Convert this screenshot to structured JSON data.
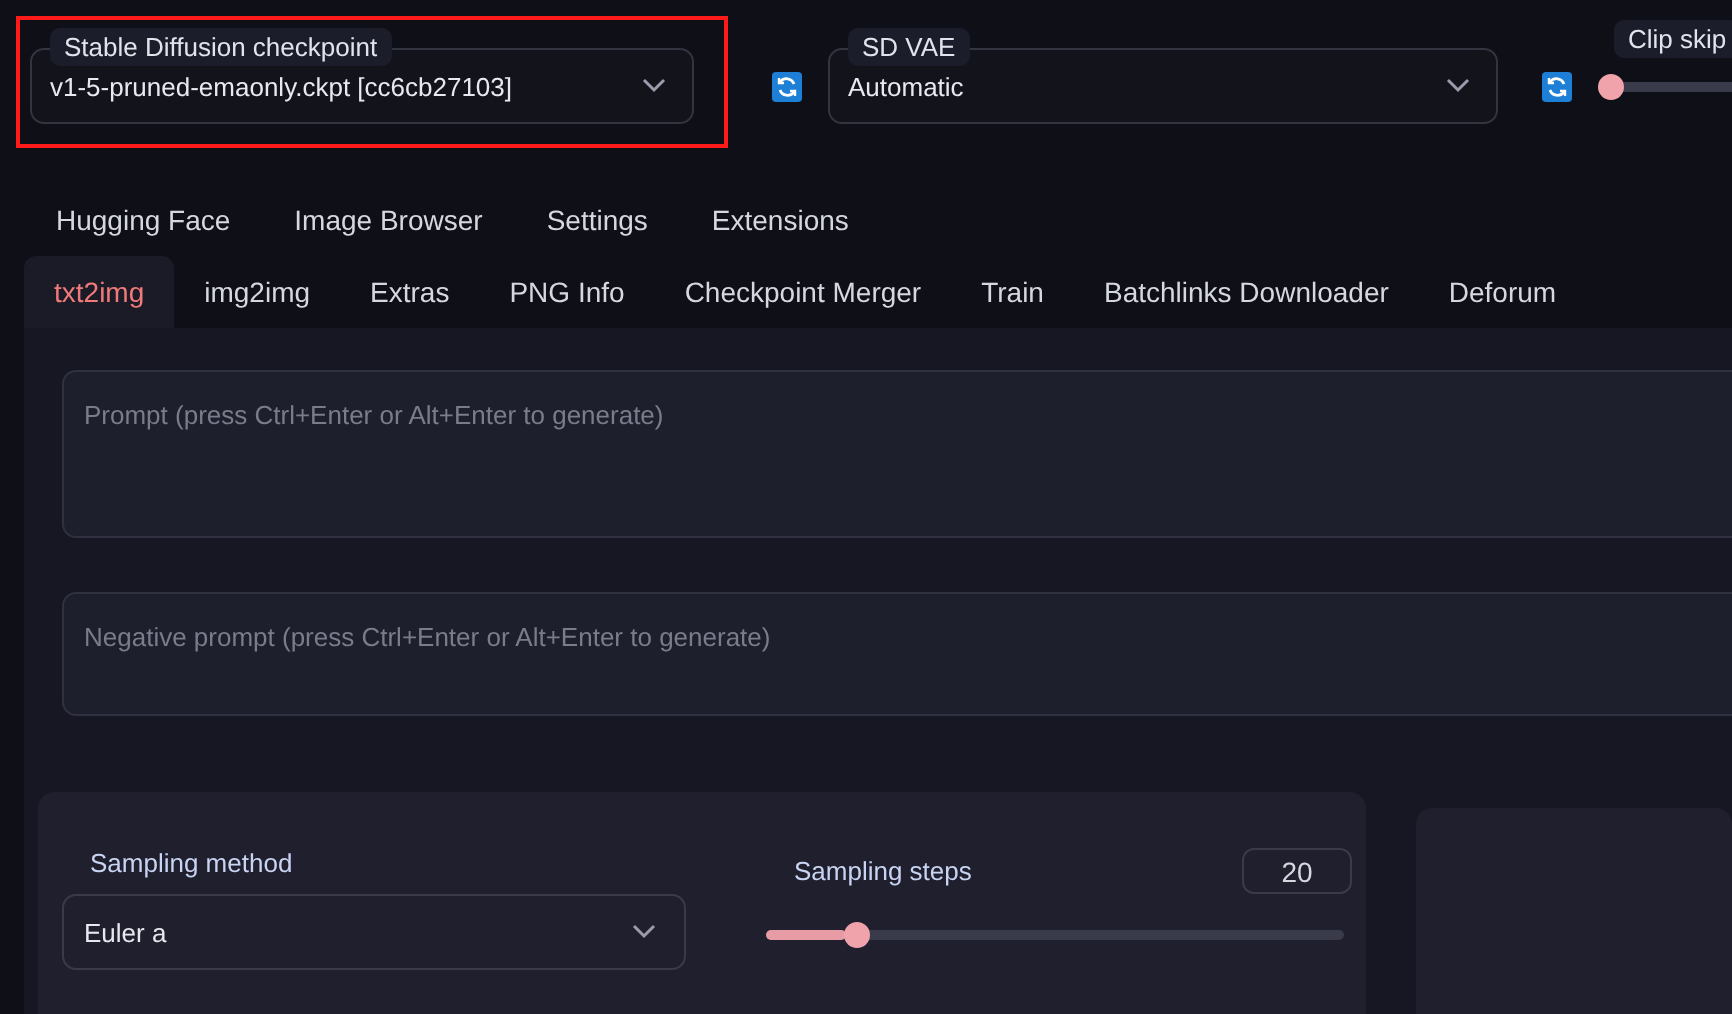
{
  "checkpoint": {
    "label": "Stable Diffusion checkpoint",
    "value": "v1-5-pruned-emaonly.ckpt [cc6cb27103]",
    "highlighted": true
  },
  "vae": {
    "label": "SD VAE",
    "value": "Automatic"
  },
  "clip_skip": {
    "label": "Clip skip",
    "level": 0
  },
  "extra_tabs": [
    {
      "label": "Hugging Face",
      "selected": false
    },
    {
      "label": "Image Browser",
      "selected": false
    },
    {
      "label": "Settings",
      "selected": false
    },
    {
      "label": "Extensions",
      "selected": false
    }
  ],
  "tabs": [
    {
      "label": "txt2img",
      "selected": true
    },
    {
      "label": "img2img",
      "selected": false
    },
    {
      "label": "Extras",
      "selected": false
    },
    {
      "label": "PNG Info",
      "selected": false
    },
    {
      "label": "Checkpoint Merger",
      "selected": false
    },
    {
      "label": "Train",
      "selected": false
    },
    {
      "label": "Batchlinks Downloader",
      "selected": false
    },
    {
      "label": "Deforum",
      "selected": false
    }
  ],
  "prompt": {
    "placeholder": "Prompt (press Ctrl+Enter or Alt+Enter to generate)"
  },
  "negative_prompt": {
    "placeholder": "Negative prompt (press Ctrl+Enter or Alt+Enter to generate)"
  },
  "sampling_method": {
    "label": "Sampling method",
    "value": "Euler a"
  },
  "sampling_steps": {
    "label": "Sampling steps",
    "value": "20",
    "level": 0.14
  }
}
